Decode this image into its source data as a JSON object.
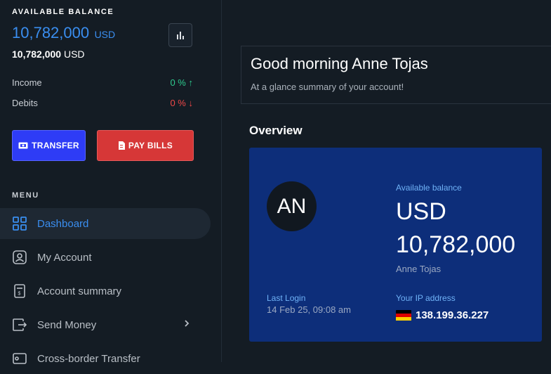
{
  "balance": {
    "heading": "AVAILABLE BALANCE",
    "amount": "10,782,000",
    "currency": "USD",
    "secondary": "10,782,000",
    "secondary_currency": "USD"
  },
  "stats": {
    "income": {
      "label": "Income",
      "value": "0 %",
      "arrow": "↑"
    },
    "debits": {
      "label": "Debits",
      "value": "0 %",
      "arrow": "↓"
    }
  },
  "actions": {
    "transfer_label": "TRANSFER",
    "paybills_label": "PAY BILLS"
  },
  "menu": {
    "heading": "MENU",
    "items": [
      {
        "label": "Dashboard",
        "icon": "dashboard-icon",
        "active": true
      },
      {
        "label": "My Account",
        "icon": "user-icon"
      },
      {
        "label": "Account summary",
        "icon": "receipt-icon"
      },
      {
        "label": "Send Money",
        "icon": "send-money-icon",
        "chevron": "›"
      },
      {
        "label": "Cross-border Transfer",
        "icon": "card-icon"
      }
    ]
  },
  "greeting": {
    "title": "Good morning Anne Tojas",
    "subtitle": "At a glance summary of your account!"
  },
  "overview": {
    "heading": "Overview",
    "avatar_initials": "AN",
    "available_label": "Available balance",
    "currency": "USD",
    "amount": "10,782,000",
    "account_name": "Anne Tojas",
    "last_login_label": "Last Login",
    "last_login_value": "14 Feb 25, 09:08 am",
    "ip_label": "Your IP address",
    "ip_value": "138.199.36.227",
    "ip_flag": "germany-flag-icon"
  },
  "colors": {
    "accent": "#3a8ef0",
    "transfer_button": "#2e3cf6",
    "paybills_button": "#d63737",
    "overview_card": "#0d2e7a",
    "positive": "#2ecc8f",
    "negative": "#f04848"
  }
}
